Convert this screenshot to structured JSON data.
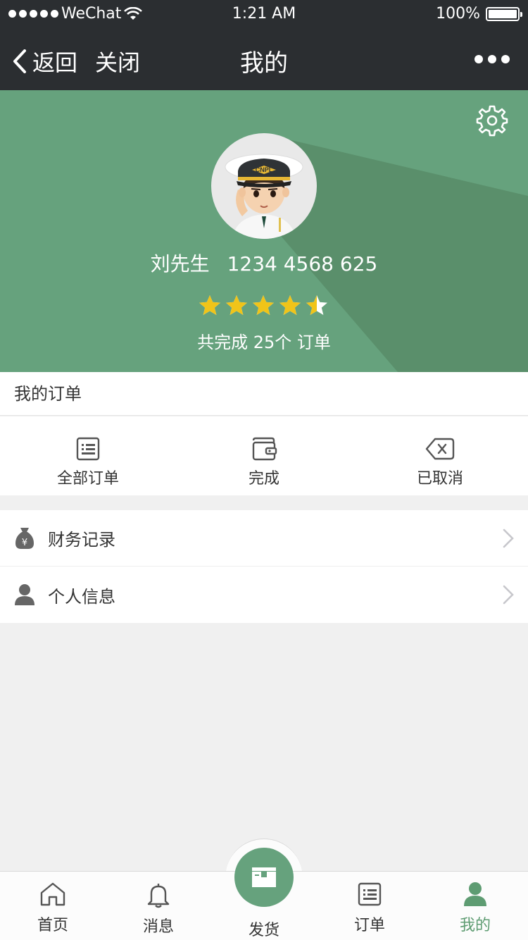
{
  "status_bar": {
    "carrier": "WeChat",
    "time": "1:21 AM",
    "battery": "100%"
  },
  "nav": {
    "back_label": "返回",
    "close_label": "关闭",
    "title": "我的"
  },
  "profile": {
    "name": "刘先生",
    "phone": "1234 4568 625",
    "rating": 4.5,
    "max_rating": 5,
    "completed_text": "共完成 25个 订单"
  },
  "orders": {
    "header": "我的订单",
    "items": [
      {
        "label": "全部订单",
        "icon": "order-list-icon"
      },
      {
        "label": "完成",
        "icon": "wallet-icon"
      },
      {
        "label": "已取消",
        "icon": "cancel-icon"
      }
    ]
  },
  "menu": [
    {
      "label": "财务记录",
      "icon": "money-bag-icon"
    },
    {
      "label": "个人信息",
      "icon": "person-icon"
    }
  ],
  "tabbar": [
    {
      "label": "首页",
      "icon": "home-icon"
    },
    {
      "label": "消息",
      "icon": "bell-icon"
    },
    {
      "label": "发货",
      "icon": "shipping-box-icon"
    },
    {
      "label": "订单",
      "icon": "order-list-icon"
    },
    {
      "label": "我的",
      "icon": "person-icon",
      "active": true
    }
  ],
  "colors": {
    "accent": "#66a27d",
    "accent_dark": "#5a8f6b",
    "star": "#f0c419",
    "nav_bg": "#2b2e31"
  }
}
